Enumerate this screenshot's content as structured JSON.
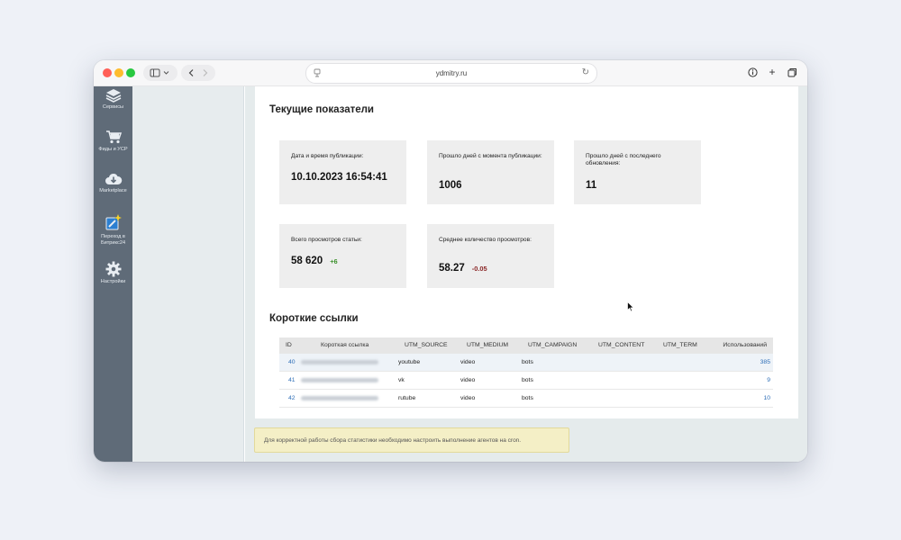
{
  "browser": {
    "url": "ydmitry.ru"
  },
  "leftbar": {
    "items": [
      {
        "label": "Сервисы",
        "icon": "layers-icon"
      },
      {
        "label": "Фиды и УСР",
        "icon": "cart-icon"
      },
      {
        "label": "Marketplace",
        "icon": "cloud-download-icon"
      },
      {
        "label": "Переход в Битрикс24",
        "icon": "sparkle-pencil-icon"
      },
      {
        "label": "Настройки",
        "icon": "gear-icon"
      }
    ]
  },
  "current_metrics": {
    "title": "Текущие показатели",
    "cards": [
      {
        "label": "Дата и время публикации:",
        "value": "10.10.2023 16:54:41"
      },
      {
        "label": "Прошло дней с момента публикации:",
        "value": "1006"
      },
      {
        "label": "Прошло дней с последнего обновления:",
        "value": "11"
      },
      {
        "label": "Всего просмотров статьи:",
        "value": "58 620",
        "delta": "+6"
      },
      {
        "label": "Среднее количество просмотров:",
        "value": "58.27",
        "delta": "-0.05"
      }
    ]
  },
  "short_links": {
    "title": "Короткие ссылки",
    "columns": [
      "ID",
      "Короткая ссылка",
      "UTM_SOURCE",
      "UTM_MEDIUM",
      "UTM_CAMPAIGN",
      "UTM_CONTENT",
      "UTM_TERM",
      "Использований"
    ],
    "rows": [
      {
        "id": "40",
        "source": "youtube",
        "medium": "video",
        "campaign": "bots",
        "content": "",
        "term": "",
        "uses": "385"
      },
      {
        "id": "41",
        "source": "vk",
        "medium": "video",
        "campaign": "bots",
        "content": "",
        "term": "",
        "uses": "9"
      },
      {
        "id": "42",
        "source": "rutube",
        "medium": "video",
        "campaign": "bots",
        "content": "",
        "term": "",
        "uses": "10"
      }
    ]
  },
  "notice": {
    "text": "Для корректной работы сбора статистики необходимо настроить выполнение агентов на cron."
  },
  "colors": {
    "sidebar": "#5f6b78",
    "card": "#eeeeee",
    "link": "#2f6fb8",
    "positive": "#3a8f2a",
    "negative": "#8a2626",
    "notice_bg": "#f4efc6"
  }
}
